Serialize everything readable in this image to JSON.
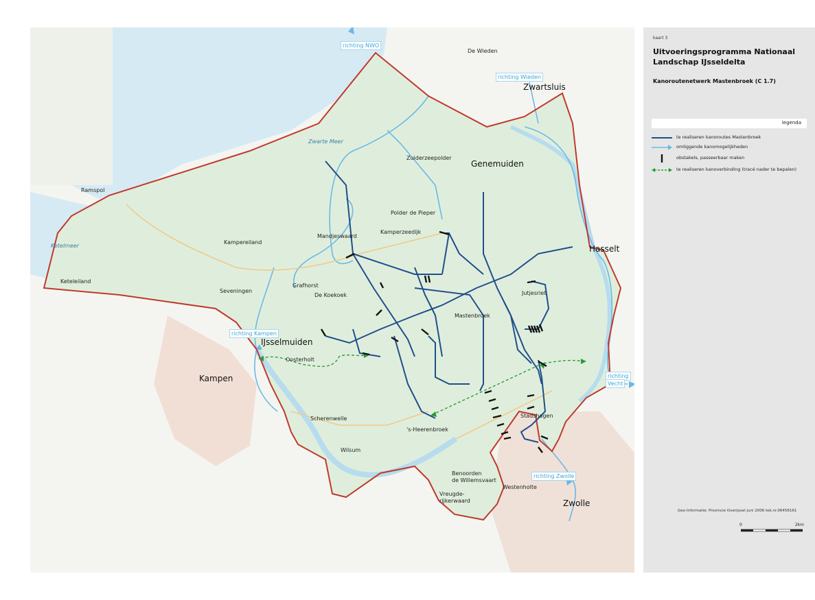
{
  "map": {
    "place_names": {
      "de_wieden": "De Wieden",
      "zwartsluis": "Zwartsluis",
      "zwarte_meer": "Zwarte Meer",
      "zuiderzeepolder": "Zuiderzeepolder",
      "genemuiden": "Genemuiden",
      "ramspol": "Ramspol",
      "ketelmeer": "Ketelmeer",
      "polder_de_pieper": "Polder de Pieper",
      "mandjeswaard": "Mandjeswaard",
      "kampereiland": "Kampereiland",
      "kamperzeedijk": "Kamperzeedijk",
      "hasselt": "Hasselt",
      "keteleiland": "Keteleiland",
      "grafhorst": "Grafhorst",
      "seveningen": "Seveningen",
      "de_koekoek": "De Koekoek",
      "jutjesriet": "Jutjesriet",
      "mastenbroek": "Mastenbroek",
      "ijsselmuiden": "IJsselmuiden",
      "oosterholt": "Oosterholt",
      "kampen": "Kampen",
      "stadshagen": "Stadshagen",
      "scherenwelle": "Scherenwelle",
      "heerenbroek": "'s-Heerenbroek",
      "wilsum": "Wilsum",
      "benoorden": "Benoorden",
      "de_willemsvaart": "de Willemsvaart",
      "westenholte": "Westenholte",
      "vreugde": "Vreugde-",
      "rijkerwaard": "rijkerwaard",
      "zwolle": "Zwolle"
    },
    "direction_labels": {
      "nwo": "richting NWO",
      "wieden": "richting Wieden",
      "kampen": "richting Kampen",
      "vecht_1": "richting",
      "vecht_2": "Vecht",
      "zwolle": "richting Zwolle"
    },
    "colors": {
      "boundary": "#c0392b",
      "route": "#1f4e8c",
      "surrounding": "#6cb8e6",
      "water": "#cfe6f2",
      "land": "#e4efe2",
      "connection": "#2e9a3a",
      "obstacle": "#111111"
    }
  },
  "panel": {
    "map_number": "kaart 3",
    "title_line1": "Uitvoeringsprogramma Nationaal",
    "title_line2": "Landschap IJsseldelta",
    "subtitle": "Kanoroutenetwerk  Mastenbroek (C 1.7)",
    "legend_header": "legenda",
    "legend": [
      {
        "symbol": "route-line",
        "label": "te realiseren kanoroutes Mastenbroek"
      },
      {
        "symbol": "surrounding-arrow",
        "label": "omliggende kanomogelijkheden"
      },
      {
        "symbol": "obstacle-bar",
        "label": "obstakels, passeerbaar maken"
      },
      {
        "symbol": "connection-dashed",
        "label": "te realiseren kanoverbinding (tracé nader te bepalen)"
      }
    ],
    "credit": "Geo-Informatie: Provincie Overijssel   juni 2006  tek.nr.06456161",
    "scale_start": "0",
    "scale_end": "2km"
  }
}
